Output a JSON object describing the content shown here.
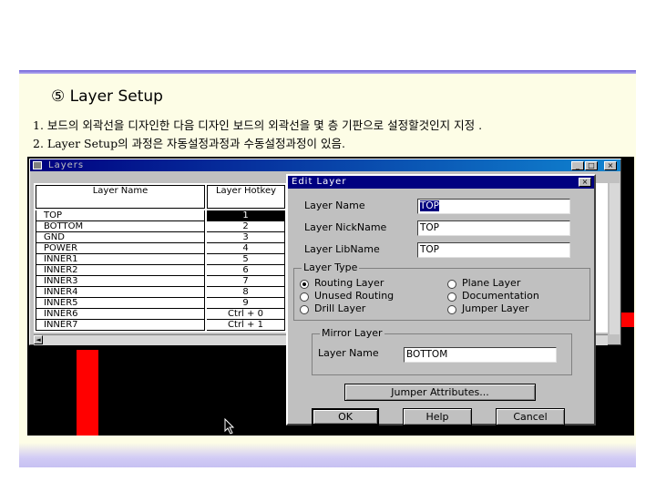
{
  "slide": {
    "heading": "⑤ Layer Setup",
    "lines": [
      "1. 보드의 외곽선을 디자인한 다음 디자인 보드의 외곽선을 몇 층 기판으로 설정할것인지 지정 .",
      "2. Layer Setup의 과정은 자동설정과정과 수동설정과정이 있음."
    ],
    "colors": {
      "top_line": "#6e5fd8",
      "slide_bg": "#fdfde6",
      "bottom_band": "#c6c0f2"
    }
  },
  "layers_window": {
    "title": "Layers",
    "title_buttons": [
      "_",
      "□",
      "×"
    ],
    "columns": [
      "Layer Name",
      "Layer Hotkey"
    ],
    "rows": [
      {
        "name": "TOP",
        "hotkey": "1",
        "selected": true
      },
      {
        "name": "BOTTOM",
        "hotkey": "2"
      },
      {
        "name": "GND",
        "hotkey": "3"
      },
      {
        "name": "POWER",
        "hotkey": "4"
      },
      {
        "name": "INNER1",
        "hotkey": "5"
      },
      {
        "name": "INNER2",
        "hotkey": "6"
      },
      {
        "name": "INNER3",
        "hotkey": "7"
      },
      {
        "name": "INNER4",
        "hotkey": "8"
      },
      {
        "name": "INNER5",
        "hotkey": "9"
      },
      {
        "name": "INNER6",
        "hotkey": "Ctrl + 0"
      },
      {
        "name": "INNER7",
        "hotkey": "Ctrl + 1"
      }
    ],
    "scroll_left": "◄"
  },
  "edit_dialog": {
    "title": "Edit Layer",
    "close": "×",
    "layer_name_label": "Layer Name",
    "layer_name_value": "TOP",
    "nickname_label": "Layer NickName",
    "nickname_value": "TOP",
    "libname_label": "Layer LibName",
    "libname_value": "TOP",
    "layer_type_legend": "Layer Type",
    "layer_types": {
      "routing": "Routing Layer",
      "plane": "Plane Layer",
      "unused": "Unused Routing",
      "documentation": "Documentation",
      "drill": "Drill Layer",
      "jumper": "Jumper Layer"
    },
    "selected_type": "Routing Layer",
    "mirror_legend": "Mirror Layer",
    "mirror_label": "Layer Name",
    "mirror_value": "BOTTOM",
    "jumper_button": "Jumper Attributes...",
    "ok_button": "OK",
    "help_button": "Help",
    "cancel_button": "Cancel"
  },
  "icons": [
    "window-icon",
    "minimize-icon",
    "maximize-icon",
    "close-icon",
    "radio-icon",
    "mouse-cursor-icon"
  ]
}
